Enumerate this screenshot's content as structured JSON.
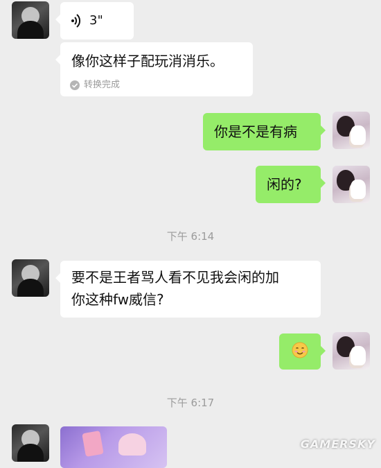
{
  "messages": {
    "voice": {
      "duration": "3\"",
      "icon": "voice-wave-icon"
    },
    "voice_text": {
      "text": "像你这样子配玩消消乐。",
      "status": "转换完成"
    },
    "me_1": {
      "text": "你是不是有病"
    },
    "me_2": {
      "text": "闲的?"
    },
    "them_2": {
      "text": "要不是王者骂人看不见我会闲的加\n你这种fw威信?"
    },
    "me_3": {
      "emoji": "smiling-face-emoji"
    }
  },
  "timestamps": {
    "t1": "下午 6:14",
    "t2": "下午 6:17"
  },
  "watermark": "GAMERSKY",
  "colors": {
    "background": "#ededed",
    "bubble_incoming": "#ffffff",
    "bubble_outgoing": "#95ec69",
    "timestamp_text": "#9b9b9b"
  }
}
